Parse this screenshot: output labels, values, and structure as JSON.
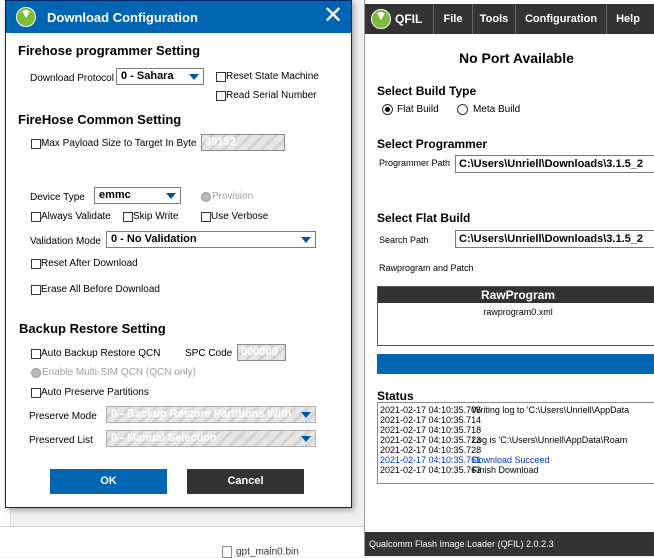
{
  "background": {
    "file_name": "gpt_main0.bin"
  },
  "dialog": {
    "title": "Download Configuration",
    "close_glyph": "✕",
    "firehose_programmer": {
      "heading": "Firehose programmer Setting",
      "download_protocol_label": "Download Protocol",
      "download_protocol_value": "0 - Sahara",
      "reset_state_machine": "Reset State Machine",
      "read_serial_number": "Read Serial Number"
    },
    "firehose_common": {
      "heading": "FireHose Common Setting",
      "max_payload_label": "Max Payload Size to Target In Byte",
      "max_payload_value": "49152",
      "device_type_label": "Device Type",
      "device_type_value": "emmc",
      "provision": "Provision",
      "always_validate": "Always Validate",
      "skip_write": "Skip Write",
      "use_verbose": "Use Verbose",
      "validation_mode_label": "Validation Mode",
      "validation_mode_value": "0 - No Validation",
      "reset_after_download": "Reset After Download",
      "erase_all_before_download": "Erase All Before Download"
    },
    "backup_restore": {
      "heading": "Backup Restore Setting",
      "auto_backup_restore_qcn": "Auto Backup Restore QCN",
      "spc_code_label": "SPC Code",
      "spc_code_value": "000000",
      "enable_multi_sim": "Enable Multi-SIM QCN (QCN only)",
      "auto_preserve_partitions": "Auto Preserve Partitions",
      "preserve_mode_label": "Preserve Mode",
      "preserve_mode_value": "0 - Backup Restore Partitions With",
      "preserved_list_label": "Preserved List",
      "preserved_list_value": "0 - Manual Selection"
    },
    "ok_label": "OK",
    "cancel_label": "Cancel"
  },
  "qfil": {
    "app_name": "QFIL",
    "menu": [
      "File",
      "Tools",
      "Configuration",
      "Help"
    ],
    "port_status": "No Port Available",
    "build_type_heading": "Select Build Type",
    "flat_build": "Flat Build",
    "meta_build": "Meta Build",
    "programmer_heading": "Select Programmer",
    "programmer_path_label": "Programmer Path",
    "programmer_path_value": "C:\\Users\\Unriell\\Downloads\\3.1.5_2",
    "flat_build_heading": "Select Flat Build",
    "search_path_label": "Search Path",
    "search_path_value": "C:\\Users\\Unriell\\Downloads\\3.1.5_2",
    "rawprogram_patch_label": "Rawprogram and Patch",
    "rawprogram_header": "RawProgram",
    "rawprogram_file": "rawprogram0.xml",
    "status_heading": "Status",
    "log": [
      {
        "ts": "2021-02-17 04:10:35.706",
        "msg": "Writing log to 'C:\\Users\\Unriell\\AppData",
        "color": "#000000"
      },
      {
        "ts": "2021-02-17 04:10:35.714",
        "msg": "",
        "color": "#000000"
      },
      {
        "ts": "2021-02-17 04:10:35.718",
        "msg": "",
        "color": "#000000"
      },
      {
        "ts": "2021-02-17 04:10:35.723",
        "msg": "Log is 'C:\\Users\\Unriell\\AppData\\Roam",
        "color": "#000000"
      },
      {
        "ts": "2021-02-17 04:10:35.728",
        "msg": "",
        "color": "#000000"
      },
      {
        "ts": "2021-02-17 04:10:35.761",
        "msg": "Download Succeed",
        "color": "#0033cc"
      },
      {
        "ts": "2021-02-17 04:10:35.763",
        "msg": "Finish Download",
        "color": "#000000"
      }
    ],
    "footer": "Qualcomm Flash Image Loader (QFIL)   2.0.2.3"
  }
}
